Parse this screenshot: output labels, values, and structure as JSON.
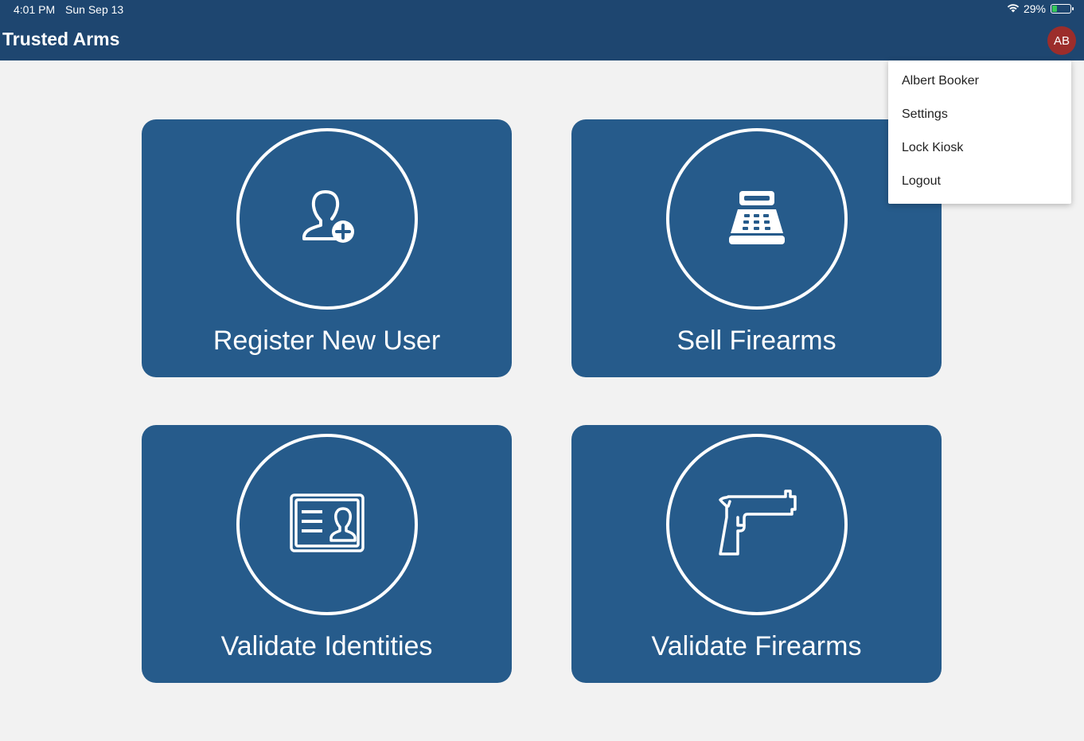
{
  "status_bar": {
    "time": "4:01 PM",
    "date": "Sun Sep 13",
    "battery": "29%",
    "battery_level": 0.29
  },
  "header": {
    "title": "Trusted Arms",
    "avatar_initials": "AB"
  },
  "user_menu": {
    "items": [
      "Albert Booker",
      "Settings",
      "Lock Kiosk",
      "Logout"
    ]
  },
  "tiles": [
    {
      "label": "Register New User",
      "icon": "add-user-icon"
    },
    {
      "label": "Sell Firearms",
      "icon": "cash-register-icon"
    },
    {
      "label": "Validate Identities",
      "icon": "id-card-icon"
    },
    {
      "label": "Validate Firearms",
      "icon": "pistol-icon"
    }
  ],
  "colors": {
    "header": "#1e4670",
    "tile": "#265b8b",
    "avatar": "#9c2d2b",
    "background": "#f2f2f2"
  }
}
